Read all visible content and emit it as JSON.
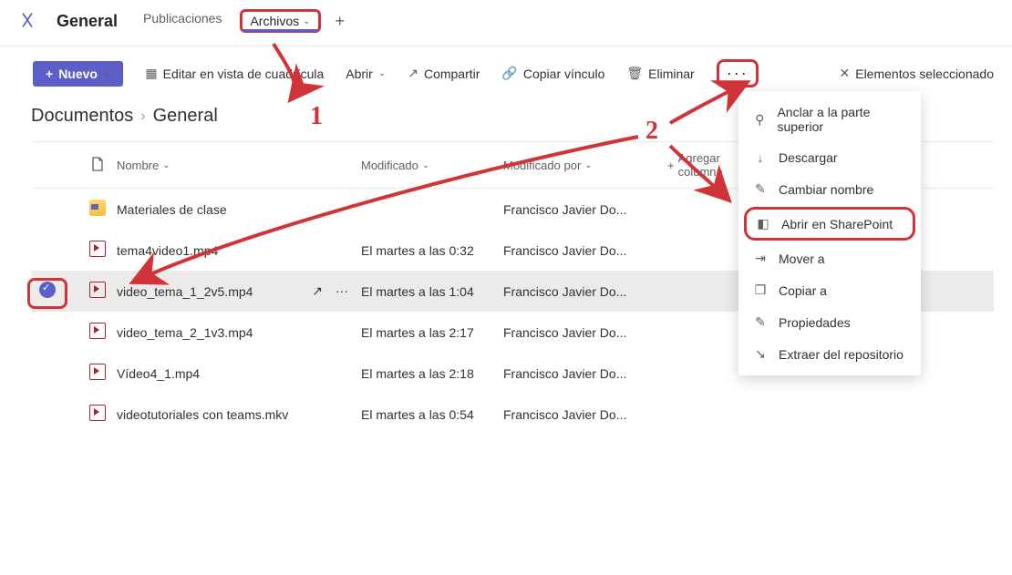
{
  "header": {
    "channel": "General",
    "tabs": [
      "Publicaciones",
      "Archivos"
    ]
  },
  "cmdbar": {
    "new": "Nuevo",
    "edit_grid": "Editar en vista de cuadrícula",
    "open": "Abrir",
    "share": "Compartir",
    "copy_link": "Copiar vínculo",
    "delete": "Eliminar",
    "selected_items": "Elementos seleccionado"
  },
  "breadcrumb": {
    "root": "Documentos",
    "current": "General"
  },
  "columns": {
    "name": "Nombre",
    "modified": "Modificado",
    "modified_by": "Modificado por",
    "add_column": "Agregar columna"
  },
  "rows": [
    {
      "type": "folder",
      "name": "Materiales de clase",
      "modified": "",
      "by": "Francisco Javier Do...",
      "selected": false
    },
    {
      "type": "video",
      "name": "tema4video1.mp4",
      "modified": "El martes a las 0:32",
      "by": "Francisco Javier Do...",
      "selected": false
    },
    {
      "type": "video",
      "name": "video_tema_1_2v5.mp4",
      "modified": "El martes a las 1:04",
      "by": "Francisco Javier Do...",
      "selected": true
    },
    {
      "type": "video",
      "name": "video_tema_2_1v3.mp4",
      "modified": "El martes a las 2:17",
      "by": "Francisco Javier Do...",
      "selected": false
    },
    {
      "type": "video",
      "name": "Vídeo4_1.mp4",
      "modified": "El martes a las 2:18",
      "by": "Francisco Javier Do...",
      "selected": false
    },
    {
      "type": "video",
      "name": "videotutoriales con teams.mkv",
      "modified": "El martes a las 0:54",
      "by": "Francisco Javier Do...",
      "selected": false
    }
  ],
  "context_menu": {
    "pin": "Anclar a la parte superior",
    "download": "Descargar",
    "rename": "Cambiar nombre",
    "open_sharepoint": "Abrir en SharePoint",
    "move_to": "Mover a",
    "copy_to": "Copiar a",
    "properties": "Propiedades",
    "checkout": "Extraer del repositorio"
  },
  "annotations": {
    "one": "1",
    "two": "2"
  }
}
